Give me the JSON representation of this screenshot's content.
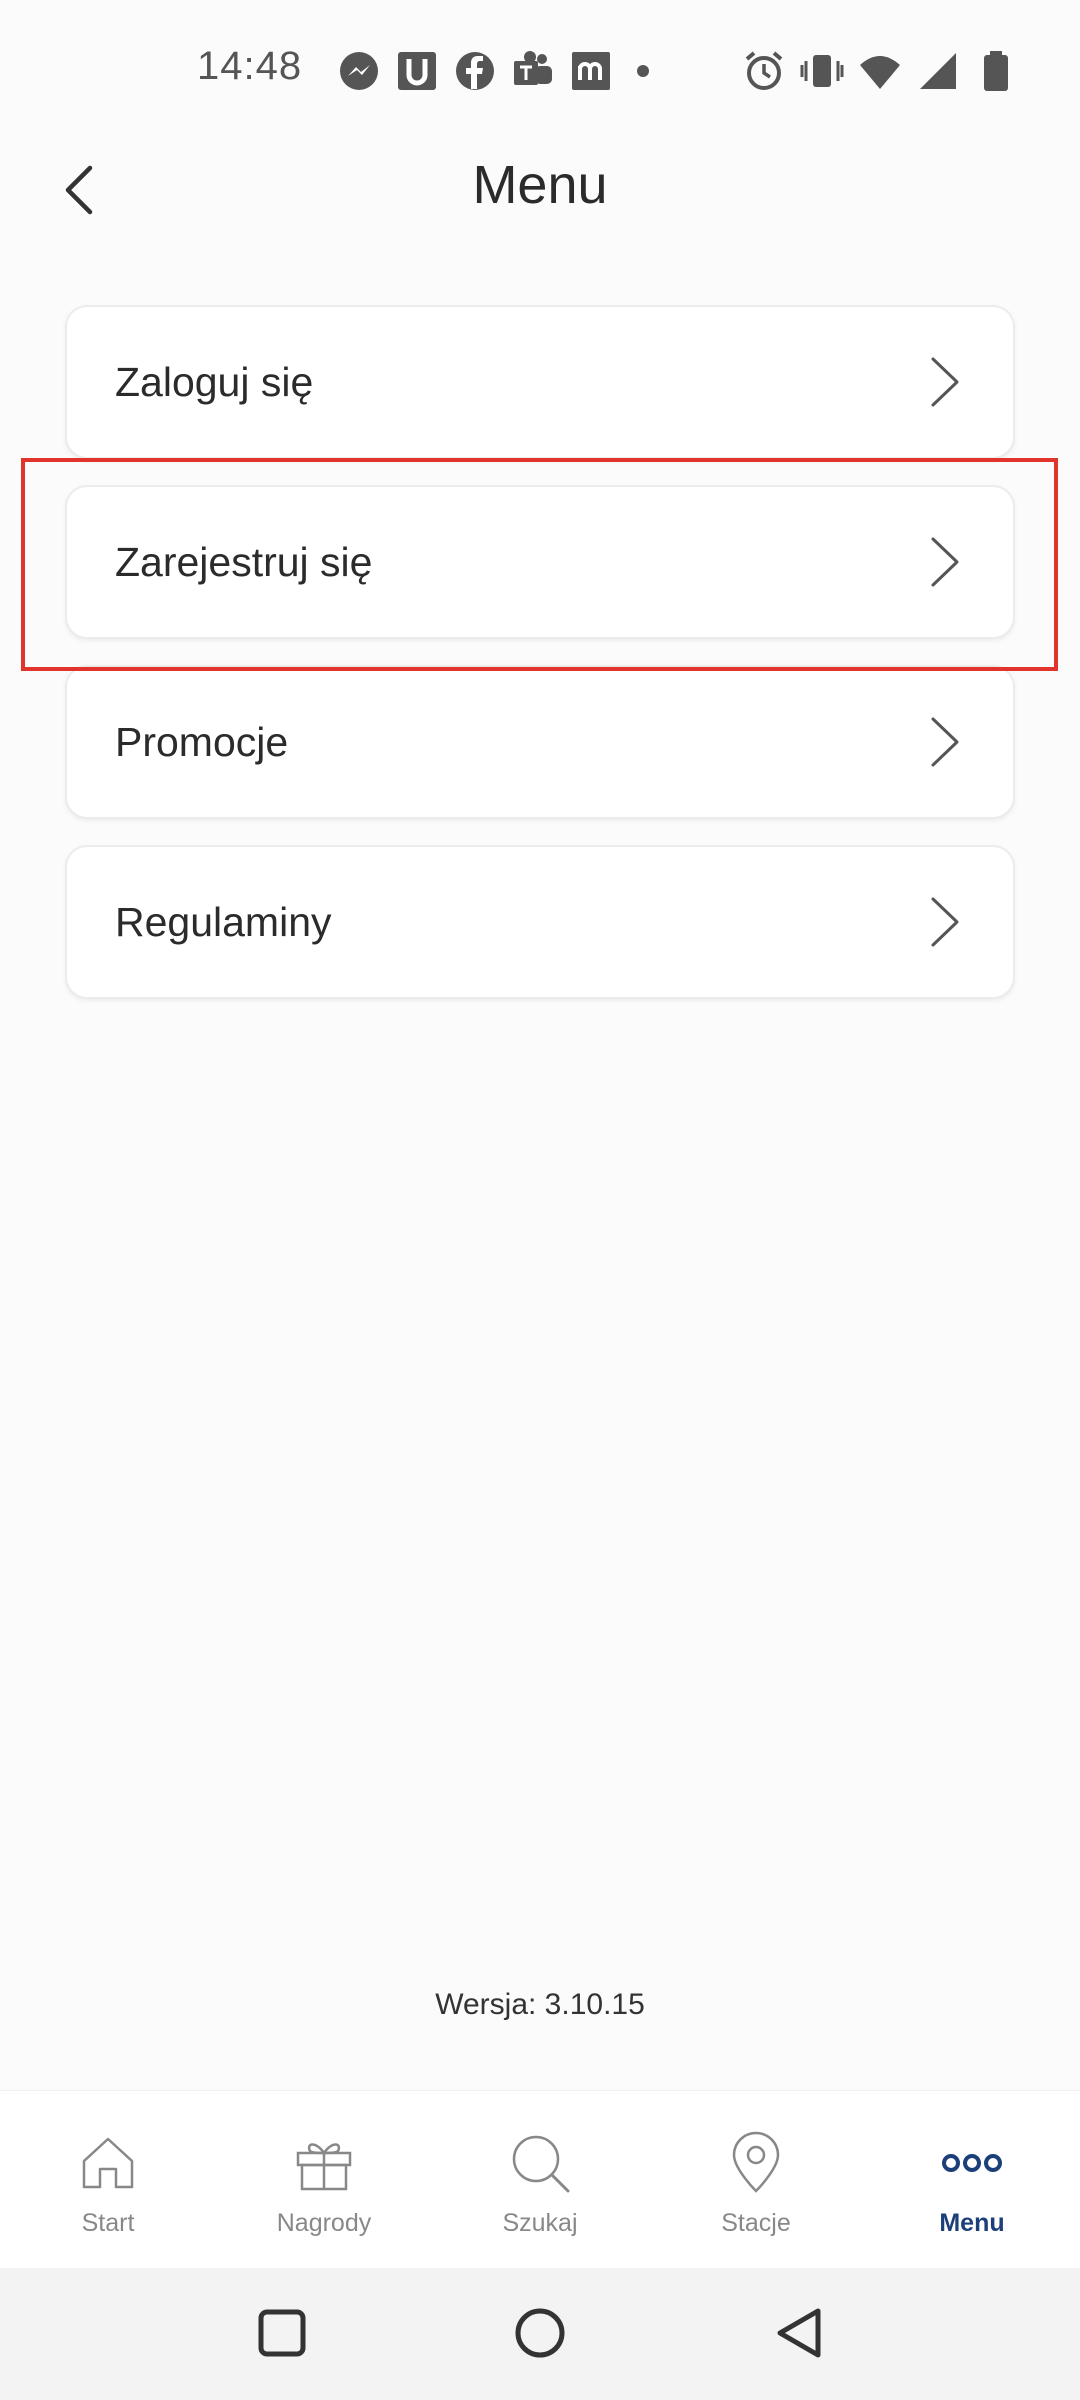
{
  "status_bar": {
    "time": "14:48",
    "left_icons": [
      "messenger-icon",
      "u-app-icon",
      "facebook-icon",
      "teams-icon",
      "m-app-icon",
      "notification-dot"
    ],
    "right_icons": [
      "alarm-icon",
      "vibrate-icon",
      "wifi-icon",
      "signal-icon",
      "battery-icon"
    ]
  },
  "header": {
    "title": "Menu",
    "back_icon": "chevron-left-icon"
  },
  "menu": {
    "items": [
      {
        "label": "Zaloguj się"
      },
      {
        "label": "Zarejestruj się"
      },
      {
        "label": "Promocje"
      },
      {
        "label": "Regulaminy"
      }
    ],
    "highlighted_index": 1,
    "highlight_color": "#e0342c"
  },
  "version": "Wersja: 3.10.15",
  "bottom_nav": {
    "items": [
      {
        "label": "Start",
        "icon": "home-icon"
      },
      {
        "label": "Nagrody",
        "icon": "gift-icon"
      },
      {
        "label": "Szukaj",
        "icon": "search-icon"
      },
      {
        "label": "Stacje",
        "icon": "location-pin-icon"
      },
      {
        "label": "Menu",
        "icon": "more-dots-icon"
      }
    ],
    "active_index": 4,
    "active_color": "#1c3f7a",
    "inactive_color": "#888888"
  },
  "system_nav": {
    "buttons": [
      "recents-icon",
      "home-circle-icon",
      "back-triangle-icon"
    ]
  }
}
